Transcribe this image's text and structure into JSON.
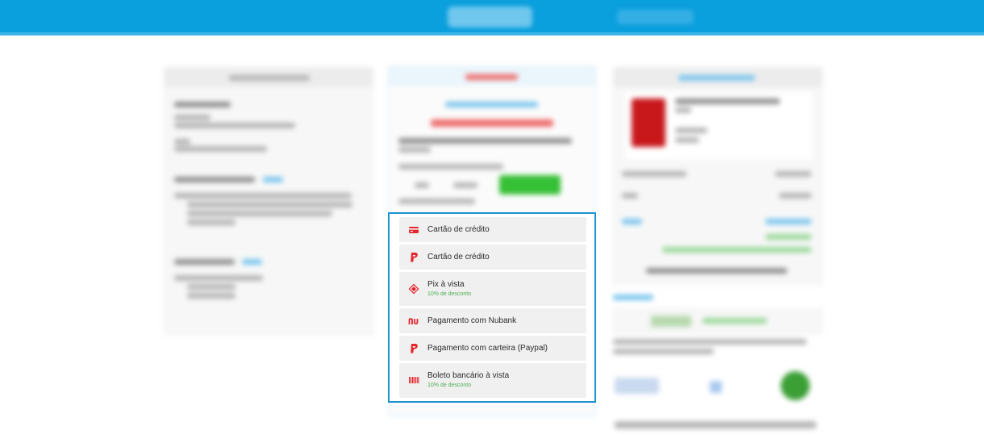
{
  "payment_methods": [
    {
      "label": "Cartão de crédito",
      "sub": "",
      "icon": "credit-card-icon"
    },
    {
      "label": "Cartão de crédito",
      "sub": "",
      "icon": "paypal-icon"
    },
    {
      "label": "Pix à vista",
      "sub": "10% de desconto",
      "icon": "pix-icon"
    },
    {
      "label": "Pagamento com Nubank",
      "sub": "",
      "icon": "nubank-icon"
    },
    {
      "label": "Pagamento com carteira (Paypal)",
      "sub": "",
      "icon": "paypal-icon"
    },
    {
      "label": "Boleto bancário à vista",
      "sub": "10% de desconto",
      "icon": "barcode-icon"
    }
  ],
  "colors": {
    "header": "#0a9fdd",
    "highlight_border": "#1b93d1",
    "icon_red": "#e5252b",
    "discount_green": "#4caf50"
  }
}
